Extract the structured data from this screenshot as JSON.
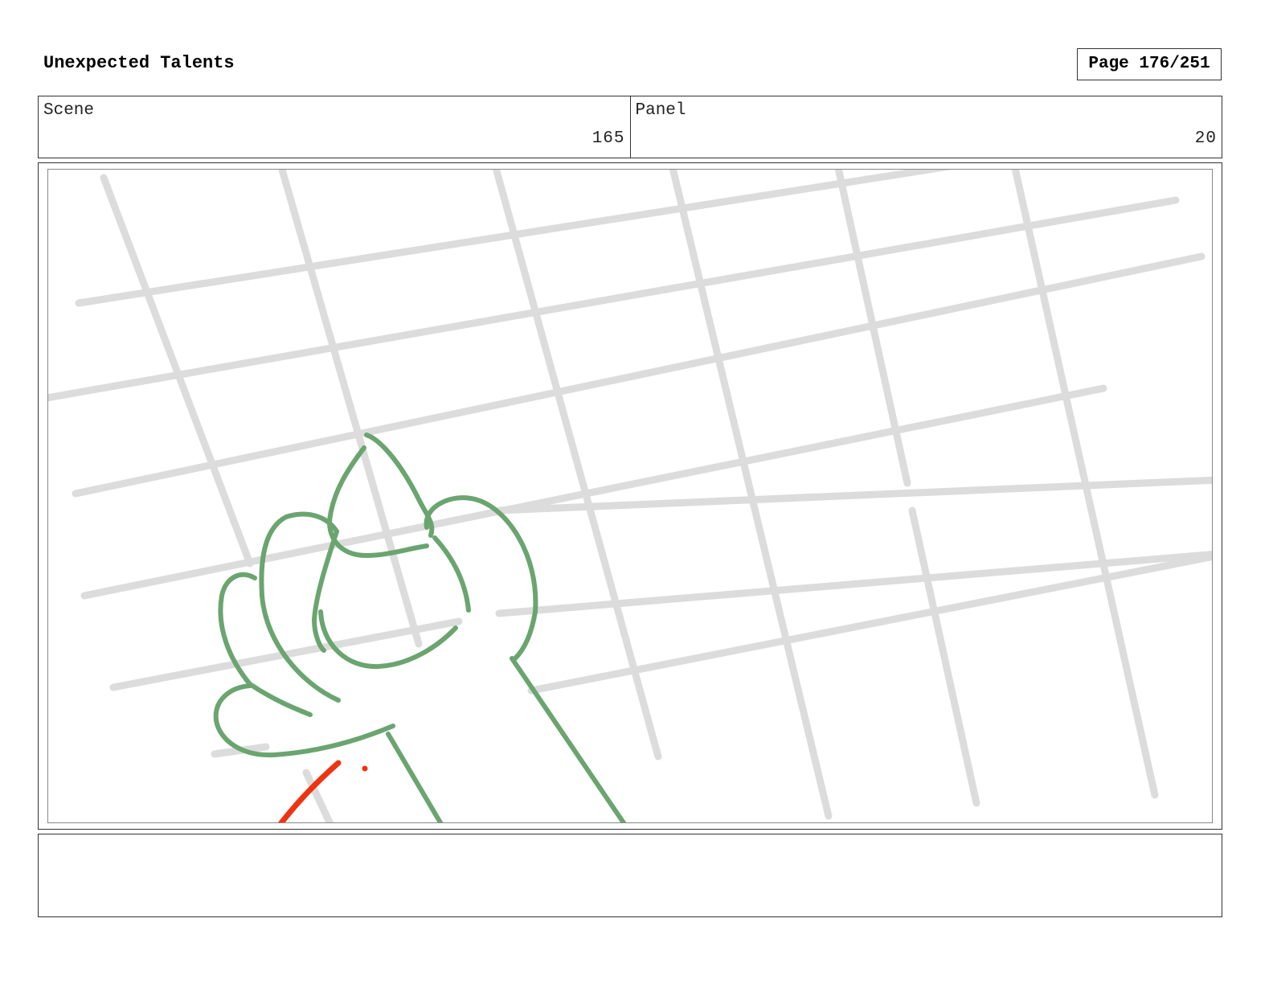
{
  "header": {
    "title": "Unexpected Talents",
    "page_label": "Page 176/251"
  },
  "info": {
    "scene_label": "Scene",
    "scene_value": "165",
    "panel_label": "Panel",
    "panel_value": "20"
  },
  "notes": {
    "text": ""
  },
  "colors": {
    "grid_lines": "#dcdcdc",
    "sketch_hand": "#6aa56f",
    "sketch_accent": "#ee3311"
  },
  "illustration": {
    "subject": "hand-sketch-over-grid"
  }
}
